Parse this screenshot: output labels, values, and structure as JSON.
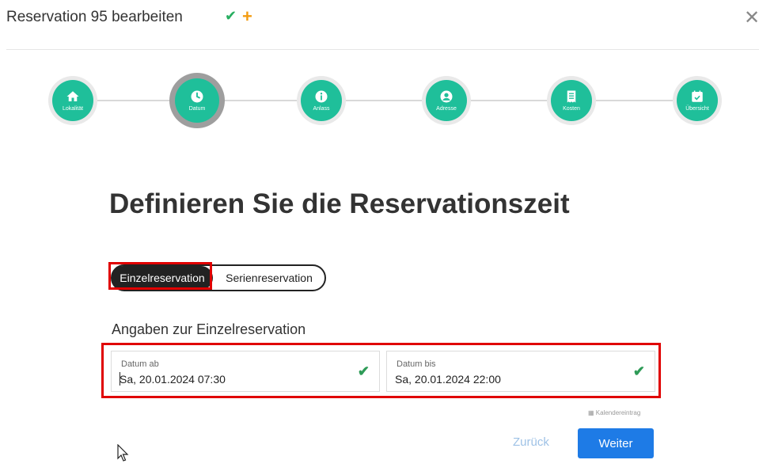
{
  "header": {
    "title": "Reservation 95 bearbeiten",
    "check_glyph": "✔",
    "plus_glyph": "+",
    "close_glyph": "✕"
  },
  "steps": [
    {
      "label": "Lokalität",
      "icon": "home-icon"
    },
    {
      "label": "Datum",
      "icon": "clock-icon",
      "active": true
    },
    {
      "label": "Anlass",
      "icon": "info-icon"
    },
    {
      "label": "Adresse",
      "icon": "user-icon"
    },
    {
      "label": "Kosten",
      "icon": "receipt-icon"
    },
    {
      "label": "Übersicht",
      "icon": "calendar-check-icon"
    }
  ],
  "main": {
    "heading": "Definieren Sie die Reservationszeit",
    "toggle": {
      "option_single": "Einzelreservation",
      "option_series": "Serienreservation",
      "selected": "Einzelreservation"
    },
    "section_title": "Angaben zur Einzelreservation",
    "fields": {
      "from": {
        "label": "Datum ab",
        "value": "Sa, 20.01.2024 07:30"
      },
      "to": {
        "label": "Datum bis",
        "value": "Sa, 20.01.2024 22:00"
      }
    },
    "calendar_link": "Kalendereintrag"
  },
  "footer": {
    "back_label": "Zurück",
    "next_label": "Weiter"
  },
  "colors": {
    "accent_green": "#1fbf9a",
    "primary_blue": "#1e7be6",
    "highlight_red": "#e00000"
  }
}
